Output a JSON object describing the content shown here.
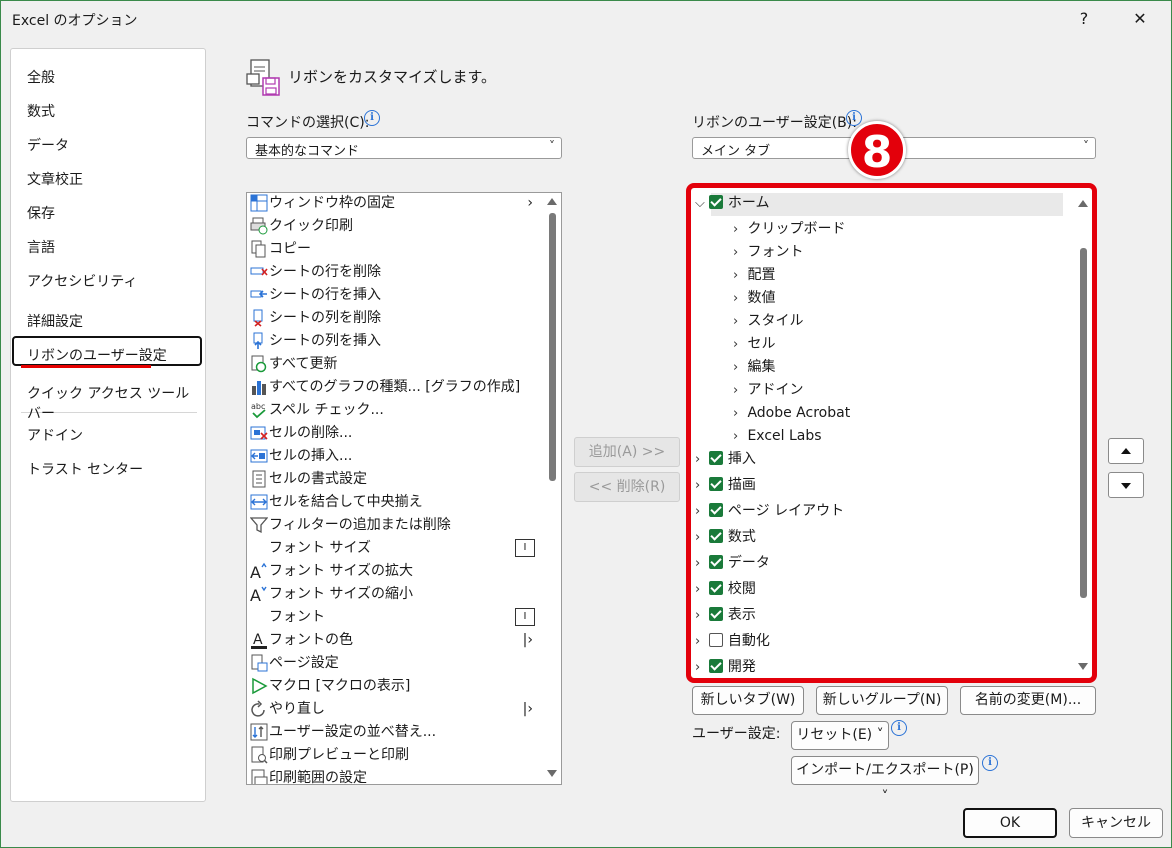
{
  "window": {
    "title": "Excel のオプション",
    "help_glyph": "?",
    "close_glyph": "✕"
  },
  "nav": {
    "items": [
      {
        "label": "全般",
        "name": "nav-general"
      },
      {
        "label": "数式",
        "name": "nav-formulas"
      },
      {
        "label": "データ",
        "name": "nav-data"
      },
      {
        "label": "文章校正",
        "name": "nav-proofing"
      },
      {
        "label": "保存",
        "name": "nav-save"
      },
      {
        "label": "言語",
        "name": "nav-language"
      },
      {
        "label": "アクセシビリティ",
        "name": "nav-accessibility"
      },
      {
        "label": "詳細設定",
        "name": "nav-advanced"
      },
      {
        "label": "リボンのユーザー設定",
        "name": "nav-customize-ribbon",
        "selected": true
      },
      {
        "label": "クイック アクセス ツール バー",
        "name": "nav-qat"
      },
      {
        "label": "アドイン",
        "name": "nav-addins"
      },
      {
        "label": "トラスト センター",
        "name": "nav-trust-center"
      }
    ]
  },
  "heading": "リボンをカスタマイズします。",
  "commands": {
    "label": "コマンドの選択(C):",
    "combo_value": "基本的なコマンド",
    "items": [
      {
        "label": "ウィンドウ枠の固定",
        "icon": "freeze-panes-icon",
        "sub": "›"
      },
      {
        "label": "クイック印刷",
        "icon": "quick-print-icon"
      },
      {
        "label": "コピー",
        "icon": "copy-icon"
      },
      {
        "label": "シートの行を削除",
        "icon": "delete-rows-icon"
      },
      {
        "label": "シートの行を挿入",
        "icon": "insert-rows-icon"
      },
      {
        "label": "シートの列を削除",
        "icon": "delete-columns-icon"
      },
      {
        "label": "シートの列を挿入",
        "icon": "insert-columns-icon"
      },
      {
        "label": "すべて更新",
        "icon": "refresh-all-icon"
      },
      {
        "label": "すべてのグラフの種類... [グラフの作成]",
        "icon": "chart-icon"
      },
      {
        "label": "スペル チェック...",
        "icon": "spelling-icon"
      },
      {
        "label": "セルの削除...",
        "icon": "delete-cells-icon"
      },
      {
        "label": "セルの挿入...",
        "icon": "insert-cells-icon"
      },
      {
        "label": "セルの書式設定",
        "icon": "format-cells-icon"
      },
      {
        "label": "セルを結合して中央揃え",
        "icon": "merge-center-icon"
      },
      {
        "label": "フィルターの追加または削除",
        "icon": "filter-icon"
      },
      {
        "label": "フォント サイズ",
        "icon": "",
        "fontbox": "I"
      },
      {
        "label": "フォント サイズの拡大",
        "icon": "font-grow-icon"
      },
      {
        "label": "フォント サイズの縮小",
        "icon": "font-shrink-icon"
      },
      {
        "label": "フォント",
        "icon": "",
        "fontbox": "I"
      },
      {
        "label": "フォントの色",
        "icon": "font-color-icon",
        "sub": "|›"
      },
      {
        "label": "ページ設定",
        "icon": "page-setup-icon"
      },
      {
        "label": "マクロ [マクロの表示]",
        "icon": "macro-icon"
      },
      {
        "label": "やり直し",
        "icon": "redo-icon",
        "sub": "|›"
      },
      {
        "label": "ユーザー設定の並べ替え...",
        "icon": "sort-icon"
      },
      {
        "label": "印刷プレビューと印刷",
        "icon": "print-preview-icon"
      },
      {
        "label": "印刷範囲の設定",
        "icon": "print-area-icon"
      }
    ]
  },
  "middle": {
    "add_label": "追加(A) >>",
    "remove_label": "<< 削除(R)"
  },
  "ribbon": {
    "label": "リボンのユーザー設定(B):",
    "combo_value": "メイン タブ",
    "tree": [
      {
        "label": "ホーム",
        "level": 0,
        "expanded": true,
        "checked": true
      },
      {
        "label": "クリップボード",
        "level": 1
      },
      {
        "label": "フォント",
        "level": 1
      },
      {
        "label": "配置",
        "level": 1
      },
      {
        "label": "数値",
        "level": 1
      },
      {
        "label": "スタイル",
        "level": 1
      },
      {
        "label": "セル",
        "level": 1
      },
      {
        "label": "編集",
        "level": 1
      },
      {
        "label": "アドイン",
        "level": 1
      },
      {
        "label": "Adobe Acrobat",
        "level": 1
      },
      {
        "label": "Excel Labs",
        "level": 1
      },
      {
        "label": "挿入",
        "level": 0,
        "checked": true
      },
      {
        "label": "描画",
        "level": 0,
        "checked": true
      },
      {
        "label": "ページ レイアウト",
        "level": 0,
        "checked": true
      },
      {
        "label": "数式",
        "level": 0,
        "checked": true
      },
      {
        "label": "データ",
        "level": 0,
        "checked": true
      },
      {
        "label": "校閲",
        "level": 0,
        "checked": true
      },
      {
        "label": "表示",
        "level": 0,
        "checked": true
      },
      {
        "label": "自動化",
        "level": 0,
        "checked": false
      },
      {
        "label": "開発",
        "level": 0,
        "checked": true
      }
    ],
    "new_tab_label": "新しいタブ(W)",
    "new_group_label": "新しいグループ(N)",
    "rename_label": "名前の変更(M)...",
    "user_settings_label": "ユーザー設定:",
    "reset_label": "リセット(E) ˅",
    "import_export_label": "インポート/エクスポート(P) ˅"
  },
  "annotation": {
    "badge_text": "8",
    "color": "#e3000b"
  },
  "footer": {
    "ok_label": "OK",
    "cancel_label": "キャンセル"
  },
  "colors": {
    "accent_green": "#1a7a3a",
    "info_blue": "#2b73d6",
    "highlight_red": "#e3000b"
  }
}
